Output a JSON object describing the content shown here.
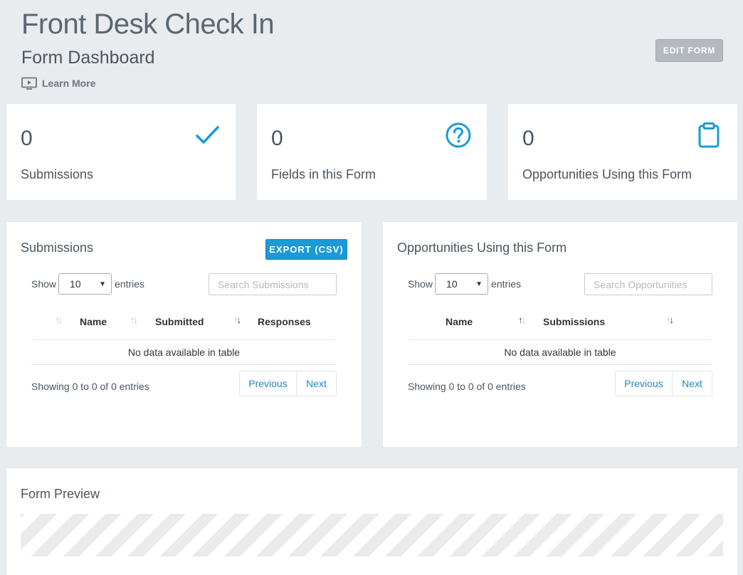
{
  "header": {
    "title": "Front Desk Check In",
    "subtitle": "Form Dashboard",
    "learn_more": "Learn More",
    "edit_form": "EDIT FORM"
  },
  "stats": [
    {
      "value": "0",
      "label": "Submissions",
      "icon": "check-icon",
      "color": "#1b9ad6"
    },
    {
      "value": "0",
      "label": "Fields in this Form",
      "icon": "question-circle-icon",
      "color": "#1b9ad6"
    },
    {
      "value": "0",
      "label": "Opportunities Using this Form",
      "icon": "clipboard-icon",
      "color": "#1b9ad6"
    }
  ],
  "submissions": {
    "title": "Submissions",
    "export": "EXPORT (CSV)",
    "show": "Show",
    "entries": "entries",
    "page_size": "10",
    "search_placeholder": "Search Submissions",
    "columns": [
      "Name",
      "Submitted",
      "Responses"
    ],
    "empty": "No data available in table",
    "info": "Showing 0 to 0 of 0 entries",
    "previous": "Previous",
    "next": "Next"
  },
  "opportunities": {
    "title": "Opportunities Using this Form",
    "show": "Show",
    "entries": "entries",
    "page_size": "10",
    "search_placeholder": "Search Opportunities",
    "columns": [
      "Name",
      "Submissions"
    ],
    "empty": "No data available in table",
    "info": "Showing 0 to 0 of 0 entries",
    "previous": "Previous",
    "next": "Next"
  },
  "preview": {
    "title": "Form Preview"
  },
  "colors": {
    "accent": "#1b9ad6",
    "background": "#e8ecef",
    "edit_button": "#b3b9be"
  }
}
